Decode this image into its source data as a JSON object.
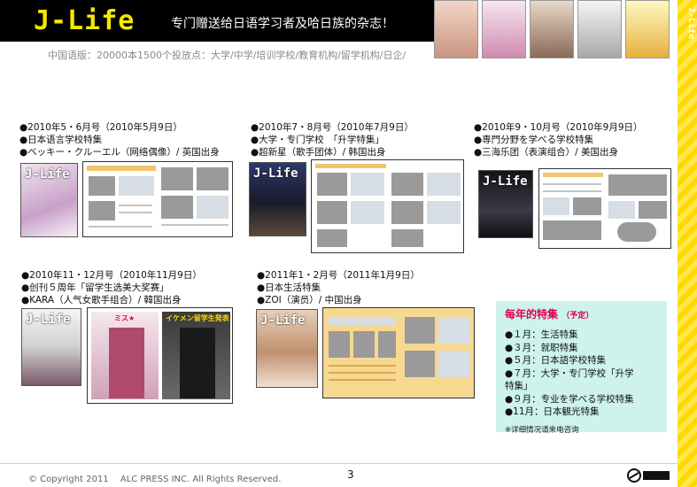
{
  "header": {
    "logo": "J-Life",
    "tagline": "专门赠送给日语学习者及哈日族的杂志！",
    "distribution": "中国语版：20000本1500个投放点：大学/中学/培训学校/教育机构/留学机构/日企/"
  },
  "side_logo": "J-Life",
  "issues": [
    {
      "lines": [
        "●2010年5・6月号（2010年5月9日）",
        "●日本语言学校特集",
        "●ベッキー・クルーエル（网络偶像）/ 英国出身"
      ]
    },
    {
      "lines": [
        "●2010年7・8月号（2010年7月9日）",
        "●大学・专门学校　「升学特集」",
        "●超新星（歌手团体）/ 韩国出身"
      ]
    },
    {
      "lines": [
        "●2010年9・10月号（2010年9月9日）",
        "●専門分野を学べる学校特集",
        "●三海乐团（表演组合）/ 美国出身"
      ]
    },
    {
      "lines": [
        "●2010年11・12月号（2010年11月9日）",
        "●创刊５周年「留学生选美大奖赛」",
        "●KARA（人气女歌手组合）/ 韓国出身"
      ]
    },
    {
      "lines": [
        "●2011年1・2月号（2011年1月9日）",
        "●日本生活特集",
        "●ZOI（演员）/ 中国出身"
      ]
    }
  ],
  "spread_texts": {
    "issue4_left": "ミス★",
    "issue4_right": "イケメン留学生発表"
  },
  "special": {
    "title": "每年的特集",
    "subtitle": "（予定）",
    "items": [
      "●１月：生活特集",
      "●３月：就职特集",
      "●５月：日本語学校特集",
      "●７月：大学・专门学校「升学",
      "特集」",
      "●９月：专业を学べる学校特集",
      "●11月：日本観光特集"
    ],
    "note": "※详细情况请来电咨询"
  },
  "footer": {
    "copyright": "© Copyright 2011　 ALC PRESS INC.  All Rights Reserved.",
    "page_number": "3"
  }
}
